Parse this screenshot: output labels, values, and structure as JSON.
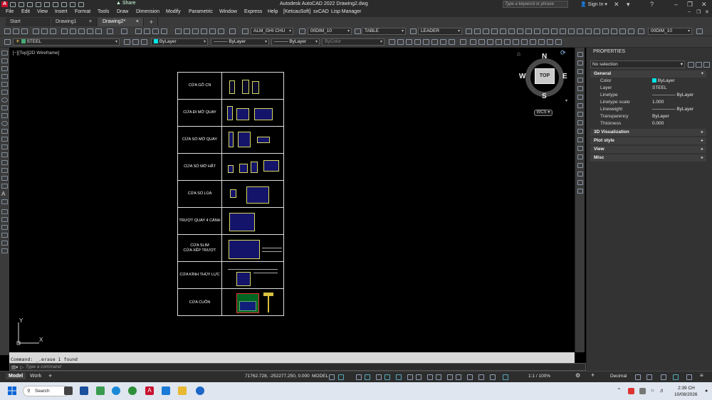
{
  "titlebar": {
    "share": "Share",
    "window_title": "Autodesk AutoCAD 2022   Drawing2.dwg",
    "search_placeholder": "Type a keyword or phrase",
    "signin": "Sign In"
  },
  "menu": [
    "File",
    "Edit",
    "View",
    "Insert",
    "Format",
    "Tools",
    "Draw",
    "Dimension",
    "Modify",
    "Parametric",
    "Window",
    "Express",
    "Help",
    "[KetcauSoft]",
    "sxCAD",
    "Lisp Manager"
  ],
  "tabs": [
    "Start",
    "Drawing1",
    "Drawing2*"
  ],
  "toolbar1": {
    "text_style": "ALM_GHI CHU",
    "dim_style": "00DIM_10",
    "table_style": "TABLE",
    "mleader_style": "LEADER",
    "dim_style_right": "00DIM_10"
  },
  "toolbar2": {
    "layer": "STEEL",
    "color": "ByLayer",
    "linetype": "ByLayer",
    "lineweight": "ByLayer",
    "plotstyle": "ByColor"
  },
  "viewport": {
    "label": "[−][Top][2D Wireframe]",
    "cube_top": "TOP",
    "compass": {
      "n": "N",
      "s": "S",
      "e": "E",
      "w": "W"
    },
    "wcs": "WCS",
    "ucs_x": "X",
    "ucs_y": "Y"
  },
  "table_rows": [
    {
      "label": "CỬA GỖ CN"
    },
    {
      "label": "CỬA ĐI MỞ QUAY"
    },
    {
      "label": "CỬA SỔ MỞ QUAY"
    },
    {
      "label": "CỬA SỔ MỞ HẤT"
    },
    {
      "label": "CỬA SỔ LÙA"
    },
    {
      "label": "TRƯỢT QUAY 4 CÁNH"
    },
    {
      "label": "CỬA SLIM\nCỬA XẾP TRƯỢT"
    },
    {
      "label": "CỬA KÍNH THỦY LỰC"
    },
    {
      "label": "CỬA CUỐN"
    }
  ],
  "command": {
    "history": "Command:  _.erase 1 found",
    "placeholder": "Type a command"
  },
  "status": {
    "model_tab": "Model",
    "work_tab": "Work",
    "coords": "71762.728, -252277.250, 0.000",
    "model_label": "MODEL",
    "scale": "1:1 / 100%",
    "units": "Decimal"
  },
  "properties": {
    "title": "PROPERTIES",
    "selection": "No selection",
    "general_header": "General",
    "rows": [
      {
        "key": "Color",
        "value": "ByLayer"
      },
      {
        "key": "Layer",
        "value": "STEEL"
      },
      {
        "key": "Linetype",
        "value": "ByLayer"
      },
      {
        "key": "Linetype scale",
        "value": "1.000"
      },
      {
        "key": "Lineweight",
        "value": "ByLayer"
      },
      {
        "key": "Transparency",
        "value": "ByLayer"
      },
      {
        "key": "Thickness",
        "value": "0.000"
      }
    ],
    "sections": [
      "3D Visualization",
      "Plot style",
      "View",
      "Misc"
    ]
  },
  "taskbar": {
    "search": "Search",
    "time": "2:39 CH",
    "date": "10/08/2026"
  },
  "colors": {
    "accent_cyan": "#00e5e5",
    "table_border": "#dddddd",
    "window_frame": "#d8d860",
    "glass": "#14146a"
  }
}
